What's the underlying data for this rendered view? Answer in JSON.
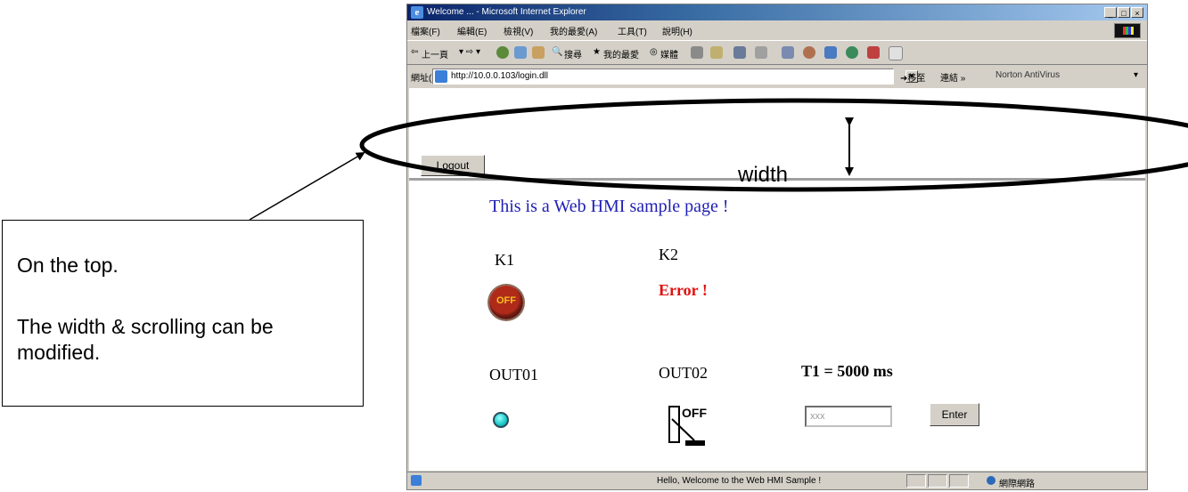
{
  "browser": {
    "title": "Welcome ... - Microsoft Internet Explorer",
    "window_controls": [
      "_",
      "□",
      "×"
    ],
    "menu": [
      "檔案(F)",
      "編輯(E)",
      "檢視(V)",
      "我的最愛(A)",
      "工具(T)",
      "說明(H)"
    ],
    "toolbar": {
      "back": "上一頁",
      "search": "搜尋",
      "favorites": "我的最愛",
      "media": "媒體"
    },
    "address": {
      "label": "網址(D)",
      "url": "http://10.0.0.103/login.dll",
      "go": "移至",
      "links": "連結",
      "norton": "Norton AntiVirus"
    },
    "status": {
      "message": "Hello, Welcome to the Web HMI Sample !",
      "zone": "網際網路"
    }
  },
  "top_frame": {
    "logout_label": "Logout"
  },
  "main_frame": {
    "heading": "This is a Web HMI sample page !",
    "k1": {
      "label": "K1",
      "lamp_text": "OFF"
    },
    "k2": {
      "label": "K2",
      "status": "Error !"
    },
    "out01": {
      "label": "OUT01"
    },
    "out02": {
      "label": "OUT02",
      "switch_text": "OFF"
    },
    "t1": {
      "label": "T1 = 5000 ms",
      "input_placeholder": "xxx",
      "enter_label": "Enter"
    }
  },
  "annotation": {
    "width_label": "width",
    "callout_line1": "On the top.",
    "callout_line2": "The width & scrolling can be modified."
  }
}
